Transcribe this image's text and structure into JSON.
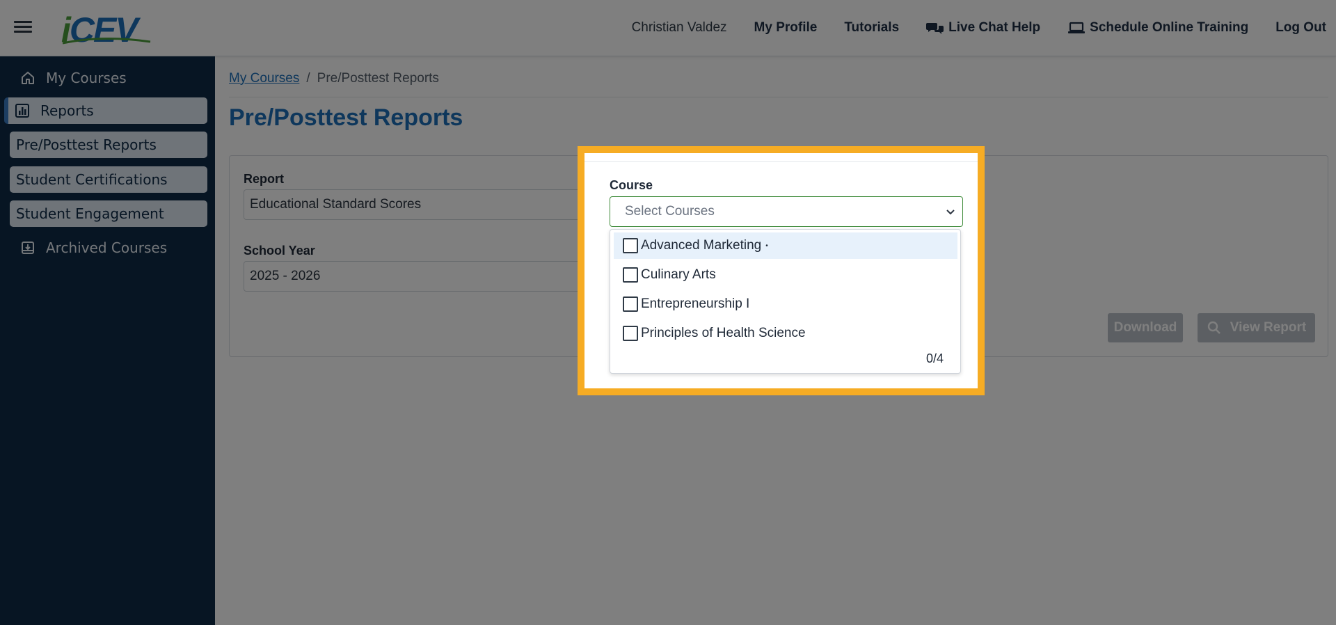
{
  "header": {
    "user_name": "Christian Valdez",
    "nav": {
      "my_profile": "My Profile",
      "tutorials": "Tutorials",
      "live_chat": "Live Chat Help",
      "schedule_training": "Schedule Online Training",
      "logout": "Log Out"
    },
    "logo_text": "CEV",
    "logo_i": "i"
  },
  "sidebar": {
    "items": [
      {
        "label": "My Courses",
        "icon": "home-icon"
      },
      {
        "label": "Reports",
        "icon": "bar-chart-icon"
      },
      {
        "label": "Pre/Posttest Reports"
      },
      {
        "label": "Student Certifications"
      },
      {
        "label": "Student Engagement"
      },
      {
        "label": "Archived Courses",
        "icon": "archive-icon"
      }
    ]
  },
  "breadcrumb": {
    "link": "My Courses",
    "separator": "/",
    "current": "Pre/Posttest Reports"
  },
  "page_title": "Pre/Posttest Reports",
  "form": {
    "report_label": "Report",
    "report_value": "Educational Standard Scores",
    "school_year_label": "School Year",
    "school_year_value": "2025 - 2026",
    "course_label": "Course",
    "course_placeholder": "Select Courses",
    "course_options": [
      {
        "label": "Advanced Marketing",
        "marker": "•"
      },
      {
        "label": "Culinary Arts"
      },
      {
        "label": "Entrepreneurship I"
      },
      {
        "label": "Principles of Health Science"
      }
    ],
    "selected_count": "0/4",
    "download_label": "Download",
    "view_report_label": "View Report"
  },
  "colors": {
    "brand_blue": "#1c6fb8",
    "sidebar_bg": "#0e2a47",
    "highlight": "#f6ac24",
    "logo_green": "#4a9d3b"
  }
}
